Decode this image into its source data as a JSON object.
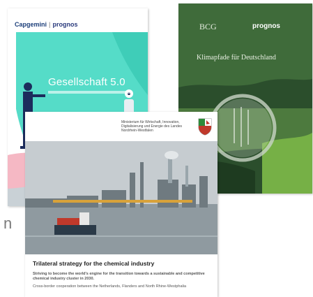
{
  "stray_text": "n",
  "cover_gesellschaft": {
    "brand_primary": "Capgemini",
    "brand_separator": "|",
    "brand_secondary": "prognos",
    "title": "Gesellschaft 5.0",
    "colors": {
      "mint": "#55dcc8",
      "pink": "#f5b8c4",
      "navy": "#1c2c5c"
    }
  },
  "cover_klimapfade": {
    "brand_primary": "BCG",
    "brand_secondary": "prognos",
    "title": "Klimapfade für Deutschland",
    "colors": {
      "forest": "#2d5a31"
    }
  },
  "cover_trilateral": {
    "ministry": "Ministerium für Wirtschaft, Innovation, Digitalisierung und Energie des Landes Nordrhein-Westfalen",
    "title": "Trilateral strategy for the chemical industry",
    "subtitle": "Striving to become the world's engine for the transition towards a sustainable and competitive chemical industry cluster in 2030.",
    "description": "Cross-border cooperation between the Netherlands, Flanders and North Rhine-Westphalia",
    "colors": {
      "water": "#8f9aa0",
      "ship": "#c0392b"
    }
  }
}
